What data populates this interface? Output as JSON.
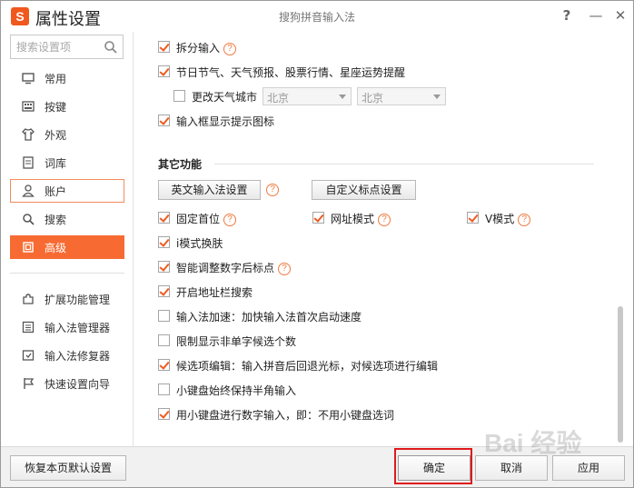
{
  "titlebar": {
    "logo": "S",
    "app_title": "属性设置",
    "window_title": "搜狗拼音输入法",
    "help": "?",
    "minimize": "—",
    "close": "✕"
  },
  "sidebar": {
    "search_placeholder": "搜索设置项",
    "items": [
      {
        "label": "常用",
        "icon": "monitor-icon"
      },
      {
        "label": "按键",
        "icon": "keyboard-icon"
      },
      {
        "label": "外观",
        "icon": "shirt-icon"
      },
      {
        "label": "词库",
        "icon": "book-icon"
      },
      {
        "label": "账户",
        "icon": "user-icon"
      },
      {
        "label": "搜索",
        "icon": "search-icon"
      },
      {
        "label": "高级",
        "icon": "advanced-icon"
      },
      {
        "label": "扩展功能管理",
        "icon": "extension-icon"
      },
      {
        "label": "输入法管理器",
        "icon": "manager-icon"
      },
      {
        "label": "输入法修复器",
        "icon": "repair-icon"
      },
      {
        "label": "快速设置向导",
        "icon": "flag-icon"
      }
    ],
    "active_item": "高级",
    "hover_item": "账户"
  },
  "content": {
    "split_input": "拆分输入",
    "holiday_reminder": "节日节气、天气预报、股票行情、星座运势提醒",
    "change_city": "更改天气城市",
    "city_province": "北京",
    "city_city": "北京",
    "show_hint_icon": "输入框显示提示图标",
    "other_features_title": "其它功能",
    "english_ime_button": "英文输入法设置",
    "custom_punct_button": "自定义标点设置",
    "fixed_first": "固定首位",
    "url_mode": "网址模式",
    "v_mode": "V模式",
    "i_mode_skin": "i模式换肤",
    "smart_punct": "智能调整数字后标点",
    "address_bar_search": "开启地址栏搜索",
    "ime_acceleration": "输入法加速：加快输入法首次启动速度",
    "limit_single_char": "限制显示非单字候选个数",
    "candidate_edit": "候选项编辑：输入拼音后回退光标，对候选项进行编辑",
    "keypad_halfwidth": "小键盘始终保持半角输入",
    "keypad_numbers": "用小键盘进行数字输入，即：不用小键盘选词",
    "help_mark": "?"
  },
  "footer": {
    "restore_defaults": "恢复本页默认设置",
    "ok": "确定",
    "cancel": "取消",
    "apply": "应用"
  },
  "watermark": "Bai 经验",
  "colors": {
    "accent": "#f76b33",
    "checkmark": "#ef5a1f",
    "highlight": "#e0191b"
  }
}
